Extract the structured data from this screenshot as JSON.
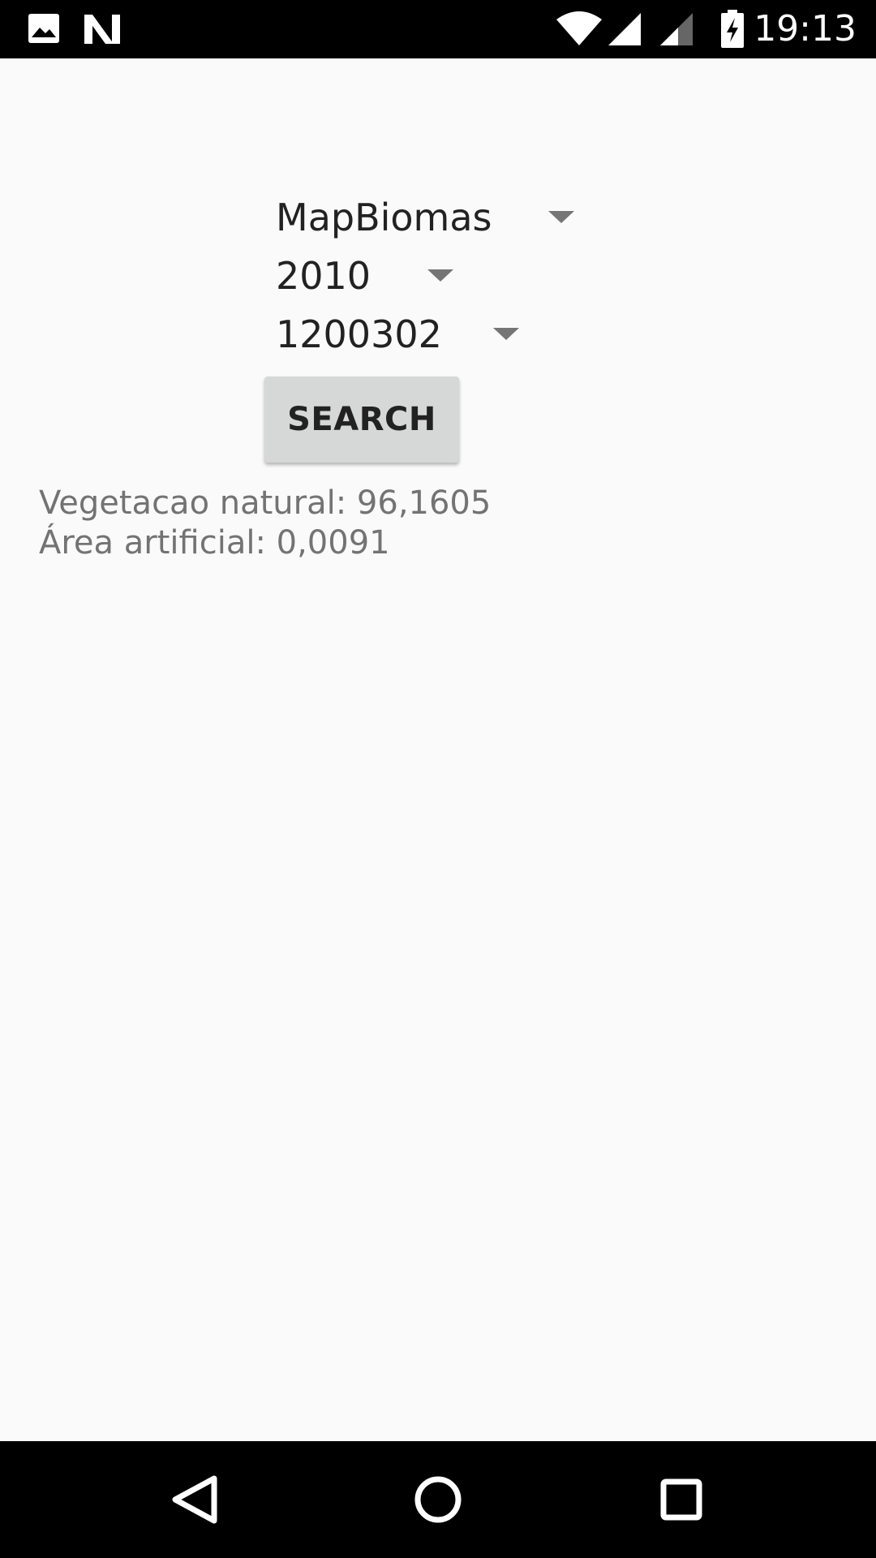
{
  "status_bar": {
    "time": "19:13",
    "icons": [
      "image-icon",
      "n-notification-icon",
      "wifi-icon",
      "cell-signal-icon",
      "cell-signal-2-icon",
      "battery-charging-icon"
    ]
  },
  "spinners": {
    "source": "MapBiomas",
    "year": "2010",
    "code": "1200302"
  },
  "search_button_label": "SEARCH",
  "results": {
    "line1": "Vegetacao natural: 96,1605",
    "line2": "Área artificial: 0,0091"
  },
  "nav_bar": {
    "icons": [
      "back-icon",
      "home-icon",
      "recents-icon"
    ]
  }
}
